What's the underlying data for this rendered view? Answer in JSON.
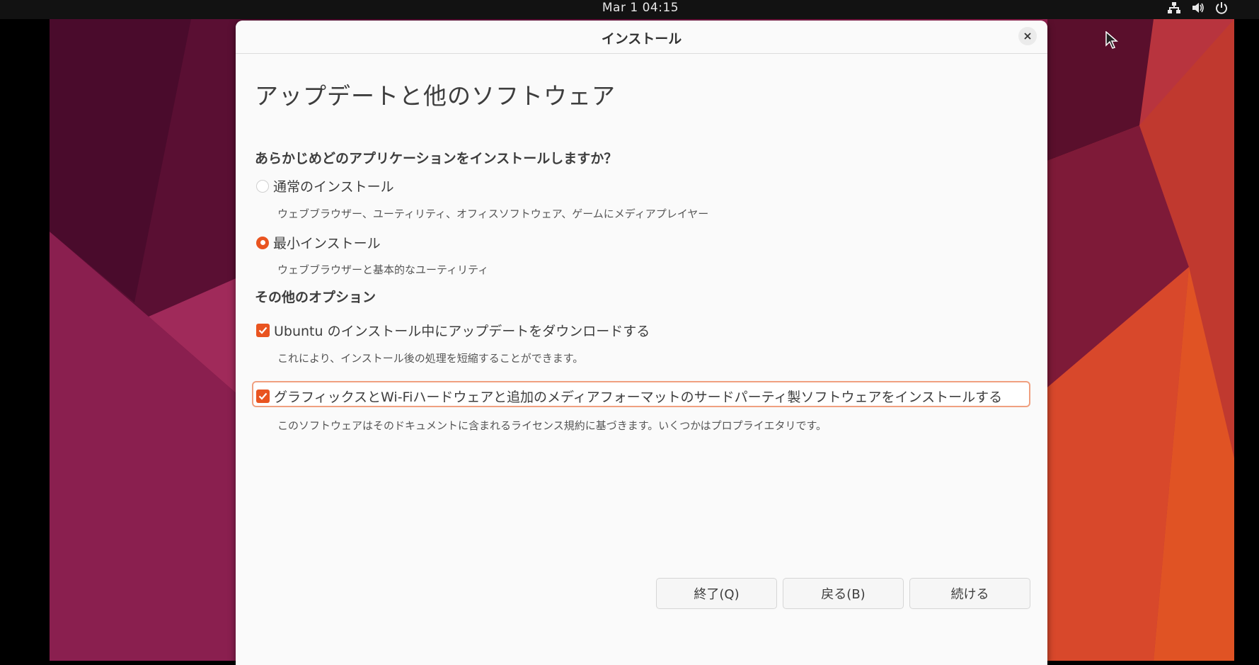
{
  "topbar": {
    "clock": "Mar 1  04:15"
  },
  "dialog": {
    "title": "インストール",
    "page_title": "アップデートと他のソフトウェア",
    "question": "あらかじめどのアプリケーションをインストールしますか？",
    "normal_install": {
      "label": "通常のインストール",
      "desc": "ウェブブラウザー、ユーティリティ、オフィスソフトウェア、ゲームにメディアプレイヤー",
      "selected": false
    },
    "minimal_install": {
      "label": "最小インストール",
      "desc": "ウェブブラウザーと基本的なユーティリティ",
      "selected": true
    },
    "other_options": "その他のオプション",
    "download_updates": {
      "label": "Ubuntu のインストール中にアップデートをダウンロードする",
      "desc": "これにより、インストール後の処理を短縮することができます。",
      "checked": true
    },
    "third_party": {
      "label": "グラフィックスとWi-Fiハードウェアと追加のメディアフォーマットのサードパーティ製ソフトウェアをインストールする",
      "desc": "このソフトウェアはそのドキュメントに含まれるライセンス規約に基づきます。いくつかはプロプライエタリです。",
      "checked": true
    },
    "buttons": {
      "quit": "終了(Q)",
      "back": "戻る(B)",
      "continue": "続ける"
    }
  },
  "icons": [
    "network-icon",
    "volume-icon",
    "power-icon",
    "close-icon",
    "mouse-cursor-icon"
  ],
  "colors": {
    "accent": "#e95420"
  }
}
